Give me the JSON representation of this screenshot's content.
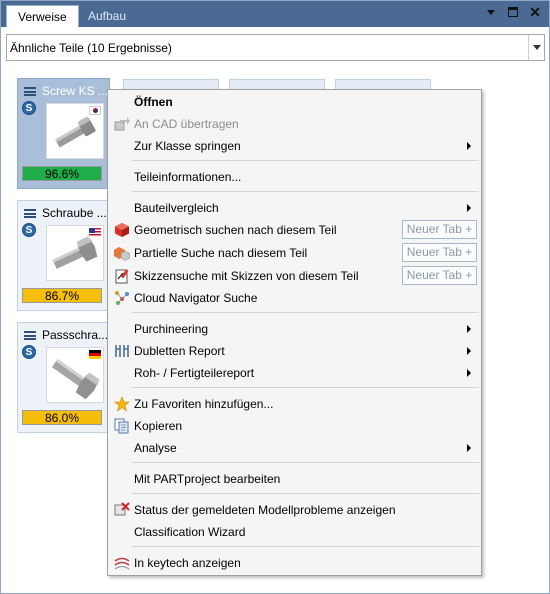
{
  "tabs": [
    {
      "label": "Verweise",
      "active": true
    },
    {
      "label": "Aufbau",
      "active": false
    }
  ],
  "window_controls": {
    "dropdown": "dropdown-icon",
    "maximize": "maximize-icon",
    "close_glyph": "✕"
  },
  "combo": {
    "value": "Ähnliche Teile (10 Ergebnisse)"
  },
  "cards": [
    {
      "title": "Screw KS ...",
      "badge": "S",
      "flag": "kr",
      "percent": "96.6%",
      "bar": "green"
    },
    {
      "title": "Schraube ...",
      "badge": "S",
      "flag": "us",
      "percent": "86.7%",
      "bar": "yellow"
    },
    {
      "title": "Passschra...",
      "badge": "S",
      "flag": "de",
      "percent": "86.0%",
      "bar": "yellow"
    }
  ],
  "menu": {
    "items": [
      {
        "label": "Öffnen",
        "bold": true
      },
      {
        "label": "An CAD übertragen",
        "disabled": true,
        "icon": "cad-transfer-icon"
      },
      {
        "label": "Zur Klasse springen",
        "submenu": true
      },
      {
        "label": "Teileinformationen..."
      },
      {
        "label": "Bauteilvergleich",
        "submenu": true
      },
      {
        "label": "Geometrisch suchen nach diesem Teil",
        "icon": "geometric-search-icon",
        "tab_button": "Neuer Tab +"
      },
      {
        "label": "Partielle Suche nach diesem Teil",
        "icon": "partial-search-icon",
        "tab_button": "Neuer Tab +"
      },
      {
        "label": "Skizzensuche mit Skizzen von diesem Teil",
        "icon": "sketch-search-icon",
        "tab_button": "Neuer Tab +"
      },
      {
        "label": "Cloud Navigator Suche",
        "icon": "cloud-navigator-icon"
      },
      {
        "label": "Purchineering",
        "submenu": true
      },
      {
        "label": "Dubletten Report",
        "icon": "duplicates-icon",
        "submenu": true
      },
      {
        "label": "Roh- / Fertigteilereport",
        "submenu": true
      },
      {
        "label": "Zu Favoriten hinzufügen...",
        "icon": "star-icon"
      },
      {
        "label": "Kopieren",
        "icon": "copy-icon"
      },
      {
        "label": "Analyse",
        "submenu": true
      },
      {
        "label": "Mit PARTproject bearbeiten"
      },
      {
        "label": "Status der gemeldeten Modellprobleme anzeigen",
        "icon": "model-issues-icon"
      },
      {
        "label": "Classification Wizard"
      },
      {
        "label": "In keytech anzeigen",
        "icon": "keytech-icon"
      }
    ]
  }
}
